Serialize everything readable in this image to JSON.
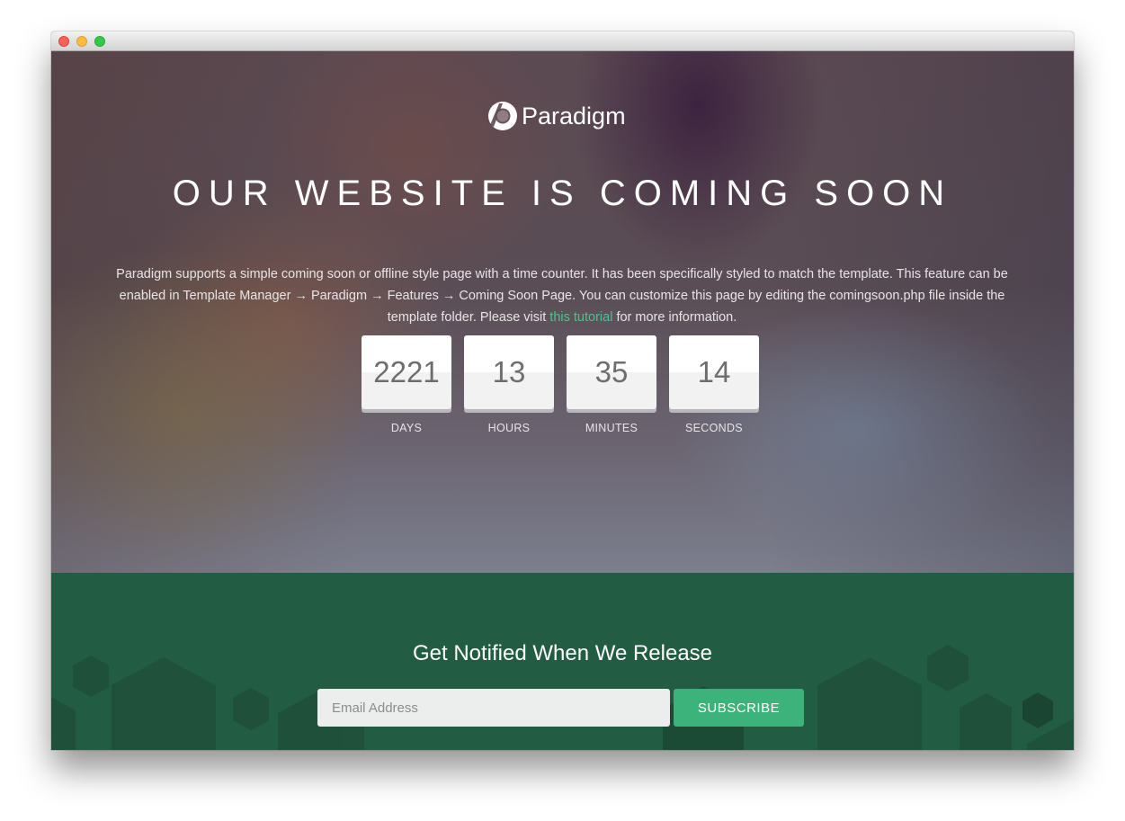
{
  "brand": {
    "name": "Paradigm",
    "logo_icon": "paradigm-logo-icon"
  },
  "hero": {
    "headline": "OUR WEBSITE IS COMING SOON",
    "description_before_link": "Paradigm supports a simple coming soon or offline style page with a time counter. It has been specifically styled to match the template. This feature can be enabled in Template Manager → Paradigm → Features → Coming Soon Page. You can customize this page by editing the comingsoon.php file inside the template folder. Please visit ",
    "link_text": "this tutorial",
    "description_after_link": " for more information."
  },
  "countdown": [
    {
      "value": "2221",
      "label": "DAYS"
    },
    {
      "value": "13",
      "label": "HOURS"
    },
    {
      "value": "35",
      "label": "MINUTES"
    },
    {
      "value": "14",
      "label": "SECONDS"
    }
  ],
  "notify": {
    "title": "Get Notified When We Release",
    "email_placeholder": "Email Address",
    "subscribe_label": "SUBSCRIBE"
  },
  "colors": {
    "accent_green": "#3cb37b",
    "link_green": "#4fc08d",
    "notify_background": "#225c43",
    "hex_shape": "#1e4f39"
  }
}
